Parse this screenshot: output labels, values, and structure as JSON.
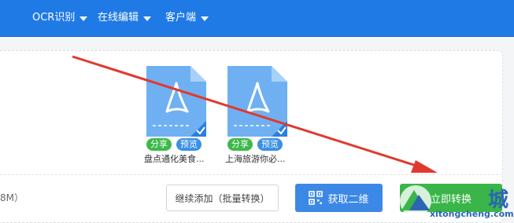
{
  "nav": {
    "items": [
      {
        "label": "OCR识别"
      },
      {
        "label": "在线编辑"
      },
      {
        "label": "客户端"
      }
    ]
  },
  "files": [
    {
      "name": "盘点通化美食...",
      "share": "分享",
      "preview": "预览"
    },
    {
      "name": "上海旅游你必...",
      "share": "分享",
      "preview": "预览"
    }
  ],
  "footer": {
    "size_text": "8M）",
    "continue_label": "继续添加（批量转换）",
    "qr_label": "获取二维",
    "convert_label": "立即转换"
  },
  "watermark": {
    "site": "xitongcheng.com",
    "char": "城"
  },
  "colors": {
    "topbar": "#1f7ae6",
    "file_icon": "#6fb0f2",
    "check": "#2b7fe0",
    "share_tag": "#3db94a",
    "preview_tag": "#3a8fe6",
    "qr_button": "#3c88e6",
    "convert_button": "#3ab549",
    "arrow": "#e03a2e"
  },
  "icons": {
    "nav_caret": "chevron-down-icon",
    "file": "pdf-file-icon",
    "selected": "checkmark-icon",
    "qr": "qr-code-icon",
    "annotation": "red-arrow"
  }
}
